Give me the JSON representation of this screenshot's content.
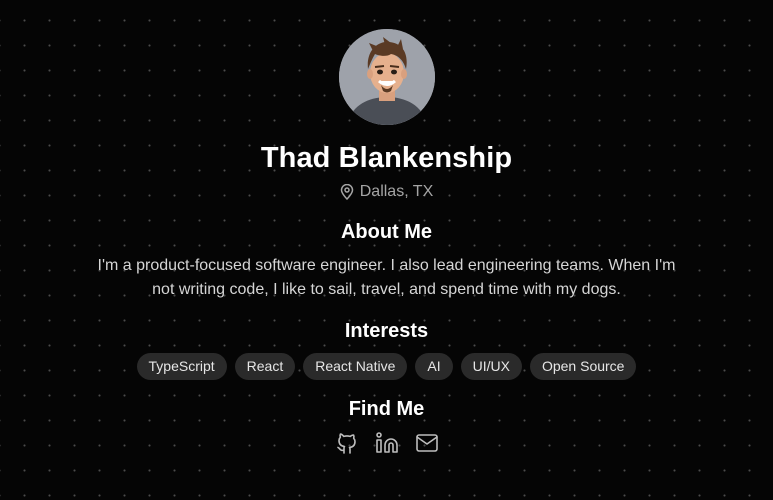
{
  "profile": {
    "name": "Thad Blankenship",
    "location": "Dallas, TX",
    "avatar_icon": "avatar-cartoon-portrait"
  },
  "about": {
    "title": "About Me",
    "text": "I'm a product-focused software engineer. I also lead engineering teams. When I'm not writing code, I like to sail, travel, and spend time with my dogs."
  },
  "interests": {
    "title": "Interests",
    "tags": [
      "TypeScript",
      "React",
      "React Native",
      "AI",
      "UI/UX",
      "Open Source"
    ]
  },
  "find_me": {
    "title": "Find Me",
    "links": [
      {
        "icon": "github-icon"
      },
      {
        "icon": "linkedin-icon"
      },
      {
        "icon": "mail-icon"
      }
    ]
  },
  "colors": {
    "background": "#050505",
    "text_primary": "#ffffff",
    "text_secondary": "#a5a5a5",
    "tag_background": "#2a2a2a"
  }
}
